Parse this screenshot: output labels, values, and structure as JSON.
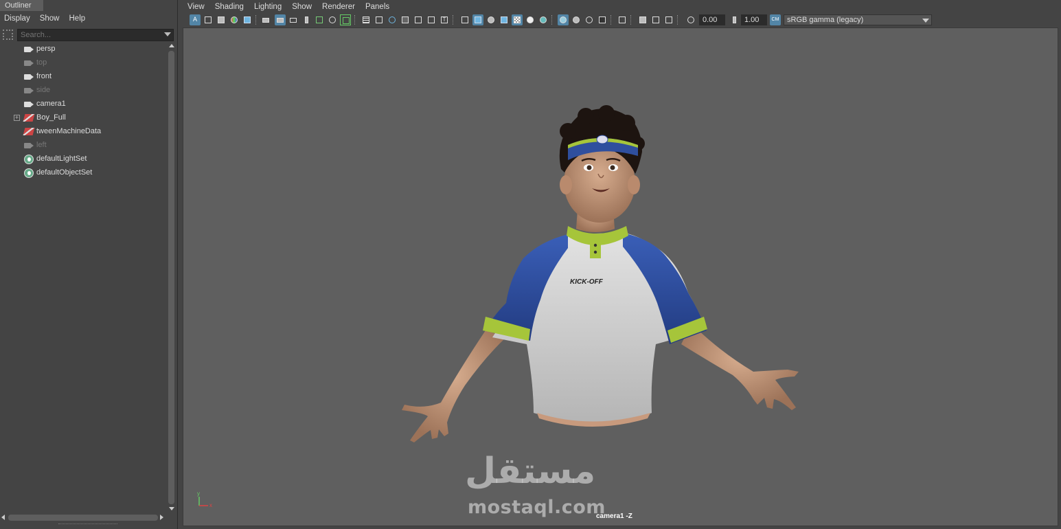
{
  "outliner": {
    "title": "Outliner",
    "menus": [
      "Display",
      "Show",
      "Help"
    ],
    "search_placeholder": "Search...",
    "items": [
      {
        "label": "persp",
        "icon": "camera-icon",
        "dim": false
      },
      {
        "label": "top",
        "icon": "camera-icon",
        "dim": true
      },
      {
        "label": "front",
        "icon": "camera-icon",
        "dim": false
      },
      {
        "label": "side",
        "icon": "camera-icon",
        "dim": true
      },
      {
        "label": "camera1",
        "icon": "camera-icon",
        "dim": false
      },
      {
        "label": "Boy_Full",
        "icon": "transform-icon",
        "dim": false,
        "expandable": true
      },
      {
        "label": "tweenMachineData",
        "icon": "transform-icon",
        "dim": false
      },
      {
        "label": "left",
        "icon": "camera-icon",
        "dim": true
      },
      {
        "label": "defaultLightSet",
        "icon": "set-icon",
        "dim": false
      },
      {
        "label": "defaultObjectSet",
        "icon": "set-icon",
        "dim": false
      }
    ]
  },
  "viewport_panel": {
    "menus": [
      "View",
      "Shading",
      "Lighting",
      "Show",
      "Renderer",
      "Panels"
    ],
    "exposure": "0.00",
    "gamma": "1.00",
    "color_space": "sRGB gamma (legacy)",
    "color_management_badge": "CM",
    "camera_label": "camera1 -Z"
  },
  "scene": {
    "shirt_text": "KICK-OFF",
    "axis_x": "x",
    "axis_y": "y"
  },
  "watermark": {
    "arabic": "مستقل",
    "latin": "mostaql.com"
  },
  "colors": {
    "shirt_sleeve": "#2f4f9e",
    "collar": "#a6c53a",
    "skin": "#c89a7d",
    "accent_blue": "#5285a6"
  }
}
